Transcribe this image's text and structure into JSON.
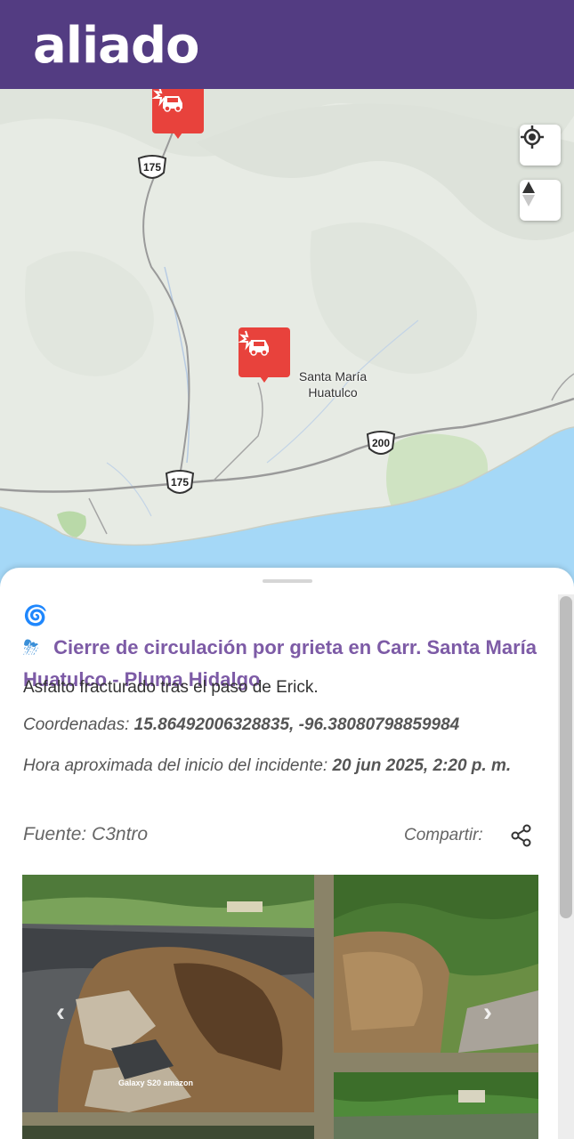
{
  "app": {
    "name": "aliado"
  },
  "map": {
    "place_label": "Santa María Huatulco",
    "route_shields": [
      "175",
      "175",
      "200"
    ],
    "controls": {
      "locate": "locate-icon",
      "compass": "compass-icon"
    },
    "markers": [
      "car-crash-icon",
      "car-crash-icon"
    ]
  },
  "incident": {
    "emoji": "🌀⛈",
    "title": "Cierre de circulación por grieta en Carr. Santa María Huatulco - Pluma Hidalgo",
    "description": "Asfalto fracturado tras el paso de Erick.",
    "coords_label": "Coordenadas:",
    "coords_value": "15.86492006328835, -96.38080798859984",
    "time_label": "Hora aproximada del inicio del incidente:",
    "time_value": "20 jun 2025, 2:20 p. m.",
    "source": "Fuente: C3ntro",
    "share_label": "Compartir:",
    "photo_caption": "Galaxy S20 amazon"
  },
  "colors": {
    "header": "#533c82",
    "title": "#7d5ba6",
    "marker": "#e8423c",
    "water": "#a5d8f7"
  }
}
